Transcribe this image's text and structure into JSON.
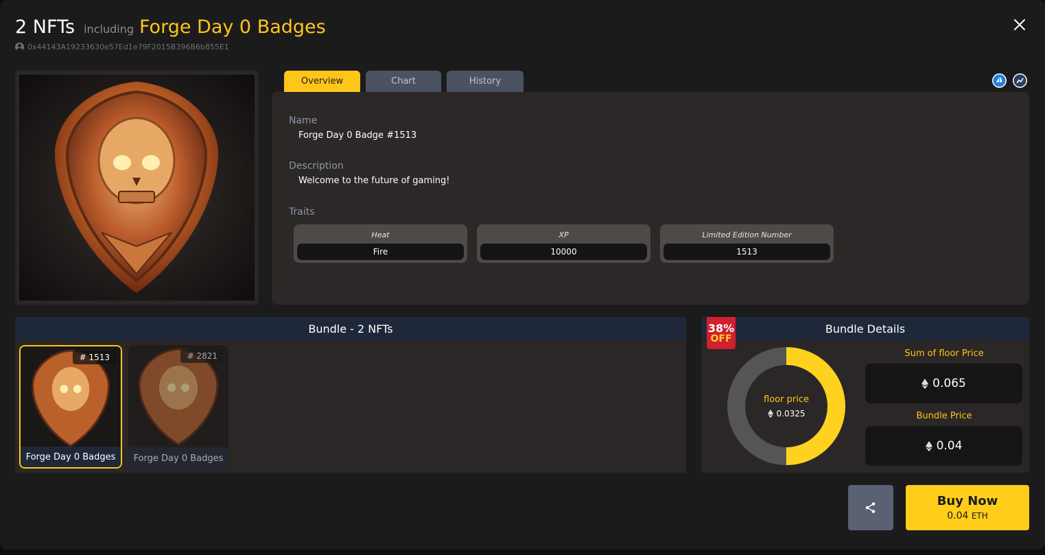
{
  "header": {
    "count": "2 NFTs",
    "including": "including",
    "collection": "Forge Day 0 Badges",
    "owner_address": "0x44143A19233630e57Ed1e79F2015B396B6b855E1"
  },
  "tabs": [
    {
      "label": "Overview",
      "active": true
    },
    {
      "label": "Chart",
      "active": false
    },
    {
      "label": "History",
      "active": false
    }
  ],
  "overview": {
    "name_label": "Name",
    "name_value": "Forge Day 0 Badge #1513",
    "description_label": "Description",
    "description_value": "Welcome to the future of gaming!",
    "traits_label": "Traits",
    "traits": [
      {
        "name": "Heat",
        "value": "Fire"
      },
      {
        "name": "XP",
        "value": "10000"
      },
      {
        "name": "Limited Edition Number",
        "value": "1513"
      }
    ]
  },
  "bundle": {
    "title": "Bundle - 2 NFTs",
    "items": [
      {
        "number": "# 1513",
        "name": "Forge Day 0 Badges",
        "selected": true
      },
      {
        "number": "# 2821",
        "name": "Forge Day 0 Badges",
        "selected": false
      }
    ]
  },
  "details": {
    "title": "Bundle Details",
    "discount_pct": "38%",
    "discount_word": "OFF",
    "floor_label": "floor price",
    "floor_value": "0.0325",
    "floor_share": 0.5,
    "sum_floor_label": "Sum of floor Price",
    "sum_floor_value": "0.065",
    "bundle_price_label": "Bundle Price",
    "bundle_price_value": "0.04"
  },
  "actions": {
    "buy_label": "Buy Now",
    "buy_price": "0.04",
    "buy_currency": "ETH"
  },
  "colors": {
    "accent": "#ffc61a",
    "panel_head": "#1e283a",
    "discount": "#d01f2e"
  }
}
